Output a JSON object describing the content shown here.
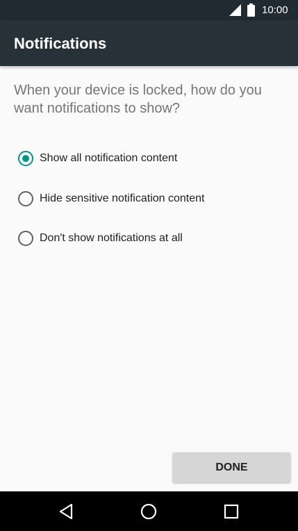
{
  "status_bar": {
    "time": "10:00",
    "icons": [
      "signal-icon",
      "battery-icon"
    ]
  },
  "app_bar": {
    "title": "Notifications"
  },
  "question": "When your device is locked, how do you want notifications to show?",
  "options": [
    {
      "label": "Show all notification content",
      "selected": true
    },
    {
      "label": "Hide sensitive notification content",
      "selected": false
    },
    {
      "label": "Don't show notifications at all",
      "selected": false
    }
  ],
  "done_button": {
    "label": "DONE"
  },
  "nav_bar": {
    "icons": [
      "back-icon",
      "home-icon",
      "recents-icon"
    ]
  },
  "colors": {
    "status_bar": "#1f2b30",
    "app_bar": "#263238",
    "accent": "#009688",
    "background": "#fafafa",
    "question_text": "#757575",
    "button": "#d6d6d6"
  }
}
